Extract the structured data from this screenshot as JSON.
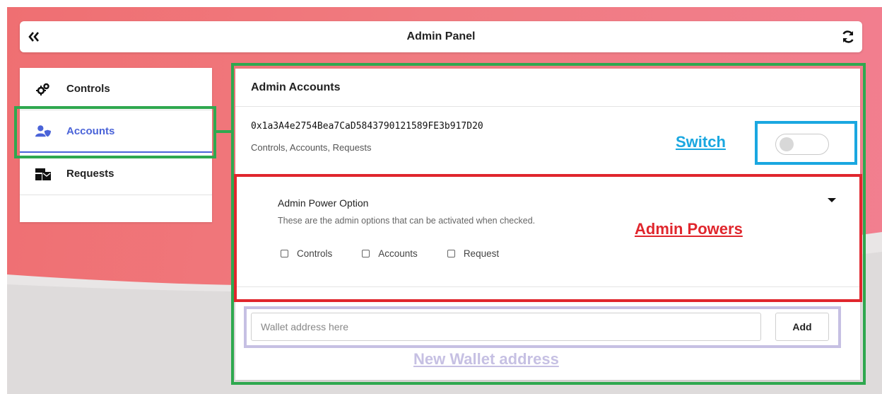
{
  "header": {
    "title": "Admin Panel",
    "collapse_icon": "double-chevron-left-icon",
    "refresh_icon": "refresh-icon"
  },
  "sidebar": {
    "items": [
      {
        "label": "Controls",
        "icon": "gears-icon",
        "active": false
      },
      {
        "label": "Accounts",
        "icon": "user-shield-icon",
        "active": true
      },
      {
        "label": "Requests",
        "icon": "mail-bulk-icon",
        "active": false
      }
    ]
  },
  "main": {
    "section_title": "Admin Accounts",
    "account": {
      "address": "0x1a3A4e2754Bea7CaD5843790121589FE3b917D20",
      "permissions": "Controls, Accounts, Requests",
      "enabled": false
    },
    "powers": {
      "title": "Admin Power Option",
      "description": "These are the admin options that can be activated when checked.",
      "options": [
        {
          "label": "Controls",
          "checked": false
        },
        {
          "label": "Accounts",
          "checked": false
        },
        {
          "label": "Request",
          "checked": false
        }
      ]
    },
    "new_wallet": {
      "placeholder": "Wallet address here",
      "value": "",
      "add_label": "Add"
    }
  },
  "annotations": {
    "switch_label": "Switch",
    "powers_label": "Admin Powers",
    "wallet_label": "New Wallet address"
  },
  "colors": {
    "accent": "#4a63d8",
    "annotation_green": "#2fa84f",
    "annotation_blue": "#1aa7e0",
    "annotation_red": "#e0262d",
    "annotation_purple": "#c6c0e3",
    "background_gradient_start": "#ef6f72",
    "background_gradient_end": "#f27f90"
  }
}
